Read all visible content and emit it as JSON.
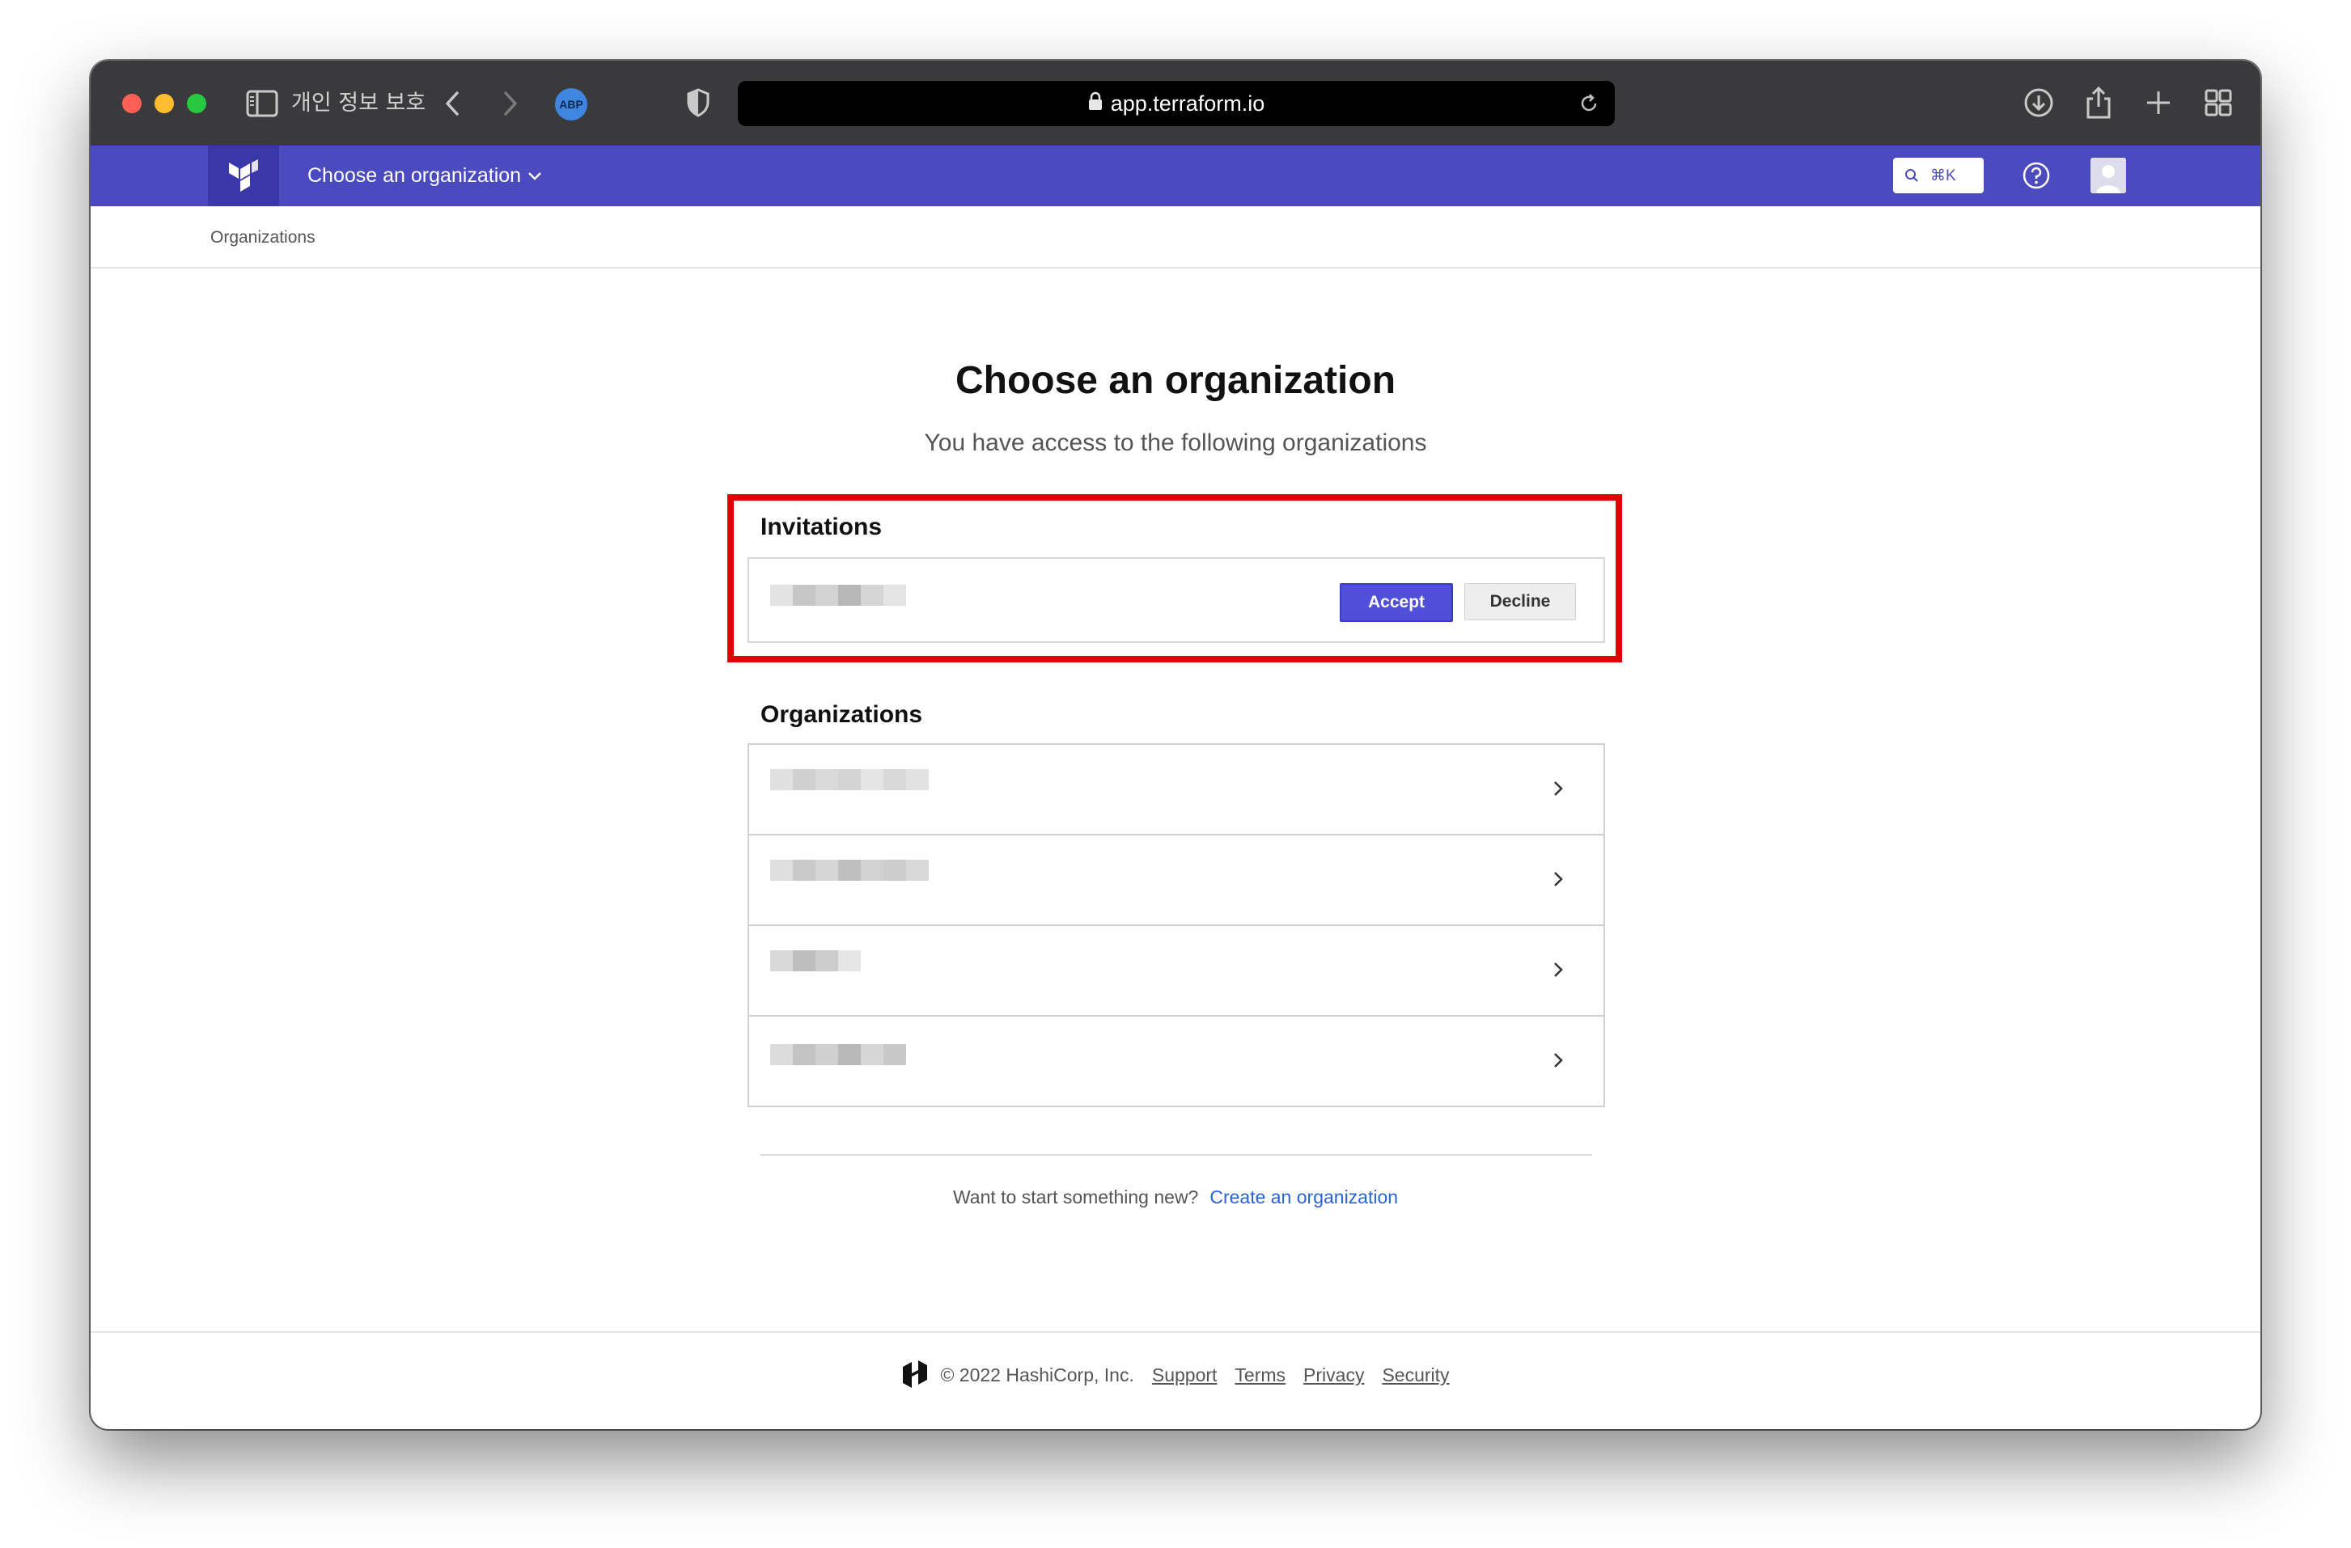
{
  "browser": {
    "privacy_label": "개인 정보 보호",
    "url": "app.terraform.io",
    "abp_label": "ABP"
  },
  "header": {
    "org_selector_label": "Choose an organization",
    "search_shortcut": "⌘K",
    "brand_color": "#4b4abf"
  },
  "breadcrumb": "Organizations",
  "main": {
    "title": "Choose an organization",
    "subtitle": "You have access to the following organizations",
    "invitations": {
      "heading": "Invitations",
      "accept_label": "Accept",
      "decline_label": "Decline"
    },
    "organizations": {
      "heading": "Organizations",
      "row_count": 4
    },
    "cta": {
      "text": "Want to start something new?",
      "link": "Create an organization"
    }
  },
  "footer": {
    "copyright": "© 2022 HashiCorp, Inc.",
    "links": [
      "Support",
      "Terms",
      "Privacy",
      "Security"
    ]
  },
  "colors": {
    "accent": "#4f4fd9",
    "highlight": "#e00000",
    "link": "#2b64d8"
  }
}
